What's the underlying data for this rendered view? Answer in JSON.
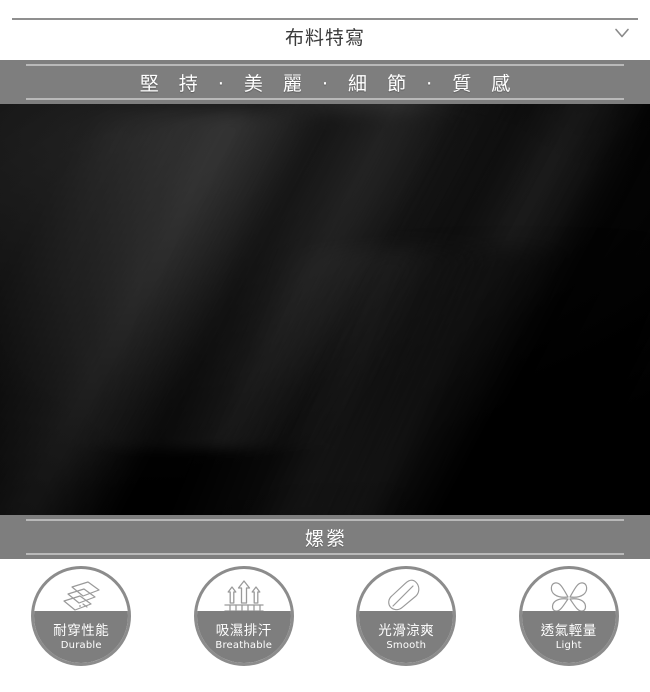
{
  "header": {
    "title": "布料特寫",
    "toggle_icon": "chevron-down-icon"
  },
  "top_banner": {
    "text": "堅 持 · 美 麗 · 細 節 · 質 感"
  },
  "photo": {
    "alt": "黑色布料特寫",
    "base_color": "#0a0a0a"
  },
  "bottom_banner": {
    "text": "嫘縈"
  },
  "features": [
    {
      "icon": "fabric-layers-icon",
      "zh": "耐穿性能",
      "en": "Durable"
    },
    {
      "icon": "moisture-wicking-arrows-icon",
      "zh": "吸濕排汗",
      "en": "Breathable"
    },
    {
      "icon": "feather-smooth-icon",
      "zh": "光滑涼爽",
      "en": "Smooth"
    },
    {
      "icon": "butterfly-light-icon",
      "zh": "透氣輕量",
      "en": "Light"
    }
  ],
  "colors": {
    "banner_gray": "#7e7e7e",
    "banner_line": "#b9b9b9",
    "rule_gray": "#8f8f8f",
    "icon_ring": "#8c8c8c",
    "text_dark": "#3b3b3b",
    "text_white": "#ffffff"
  }
}
